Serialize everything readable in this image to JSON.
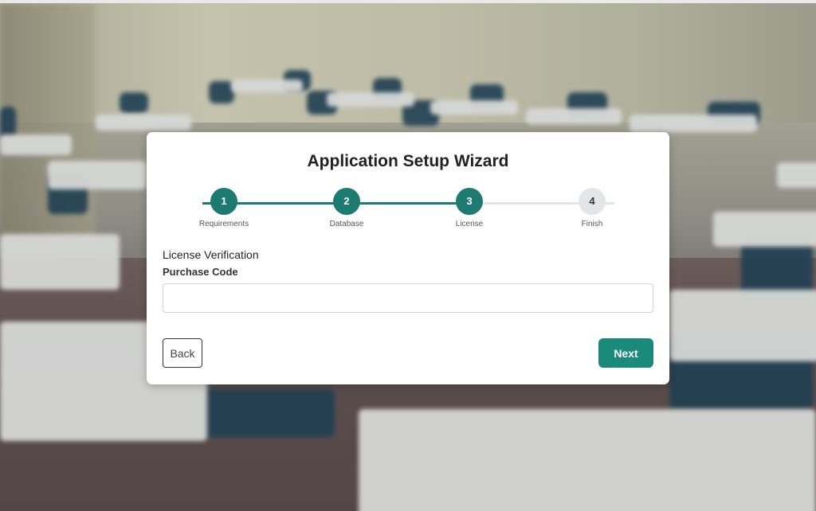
{
  "wizard": {
    "title": "Application Setup Wizard",
    "steps": [
      {
        "number": "1",
        "label": "Requirements",
        "status": "complete"
      },
      {
        "number": "2",
        "label": "Database",
        "status": "complete"
      },
      {
        "number": "3",
        "label": "License",
        "status": "active"
      },
      {
        "number": "4",
        "label": "Finish",
        "status": "pending"
      }
    ],
    "section_title": "License Verification",
    "purchase_code": {
      "label": "Purchase Code",
      "value": "",
      "placeholder": ""
    },
    "back_label": "Back",
    "next_label": "Next"
  },
  "colors": {
    "accent": "#1a8a7b",
    "step_complete": "#1c7a70",
    "step_pending": "#e3e5e8"
  }
}
